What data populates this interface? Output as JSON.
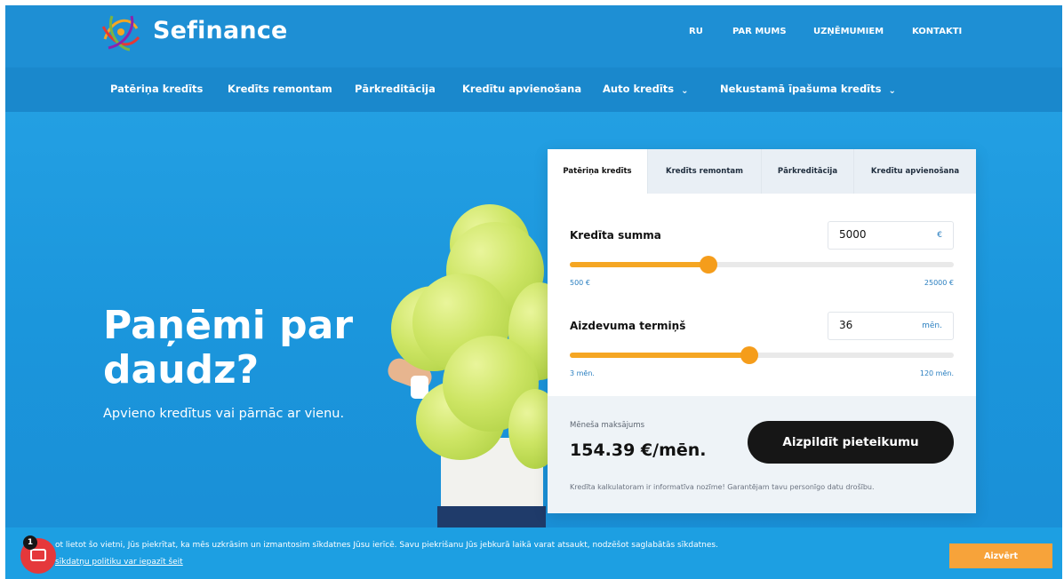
{
  "brand": {
    "name": "Sefinance",
    "logo_icon": "sefinance-logo-icon"
  },
  "top_nav": [
    "RU",
    "PAR MUMS",
    "UZŅĒMUMIEM",
    "KONTAKTI"
  ],
  "main_nav": [
    {
      "label": "Patēriņa kredīts",
      "dropdown": false
    },
    {
      "label": "Kredīts remontam",
      "dropdown": false
    },
    {
      "label": "Pārkreditācija",
      "dropdown": false
    },
    {
      "label": "Kredītu apvienošana",
      "dropdown": false
    },
    {
      "label": "Auto kredīts",
      "dropdown": true
    },
    {
      "label": "Nekustamā īpašuma kredīts",
      "dropdown": true
    }
  ],
  "hero": {
    "title": "Paņēmi par daudz?",
    "subtitle": "Apvieno kredītus vai pārnāc ar vienu."
  },
  "calculator": {
    "tabs": [
      "Patēriņa kredīts",
      "Kredīts remontam",
      "Pārkreditācija",
      "Kredītu apvienošana"
    ],
    "active_tab": 0,
    "amount": {
      "label": "Kredīta summa",
      "value": "5000",
      "unit": "€",
      "min_label": "500 €",
      "max_label": "25000 €",
      "min": 500,
      "max": 25000,
      "current": 5000
    },
    "term": {
      "label": "Aizdevuma termiņš",
      "value": "36",
      "unit": "mēn.",
      "min_label": "3 mēn.",
      "max_label": "120 mēn.",
      "min": 3,
      "max": 120,
      "current": 36
    },
    "monthly_label": "Mēneša maksājums",
    "monthly_value": "154.39 €/mēn.",
    "apply_button": "Aizpildīt pieteikumu",
    "disclaimer": "Kredīta kalkulatoram ir informatīva nozīme! Garantējam tavu personīgo datu drošību."
  },
  "cookie_bar": {
    "text": "ot lietot šo vietni, Jūs piekrītat, ka mēs uzkrāsim un izmantosim sīkdatnes Jūsu ierīcē. Savu piekrišanu Jūs jebkurā laikā varat atsaukt, nodzēšot saglabātās sīkdatnes.",
    "link": "sīkdatņu politiku var iepazīt šeit",
    "close_button": "Aizvērt"
  },
  "chat": {
    "badge": "1",
    "icon": "chat-icon"
  },
  "colors": {
    "primary_blue": "#1e8fd4",
    "accent_orange": "#f59d1b",
    "button_dark": "#161616",
    "chat_red": "#e5383b"
  }
}
